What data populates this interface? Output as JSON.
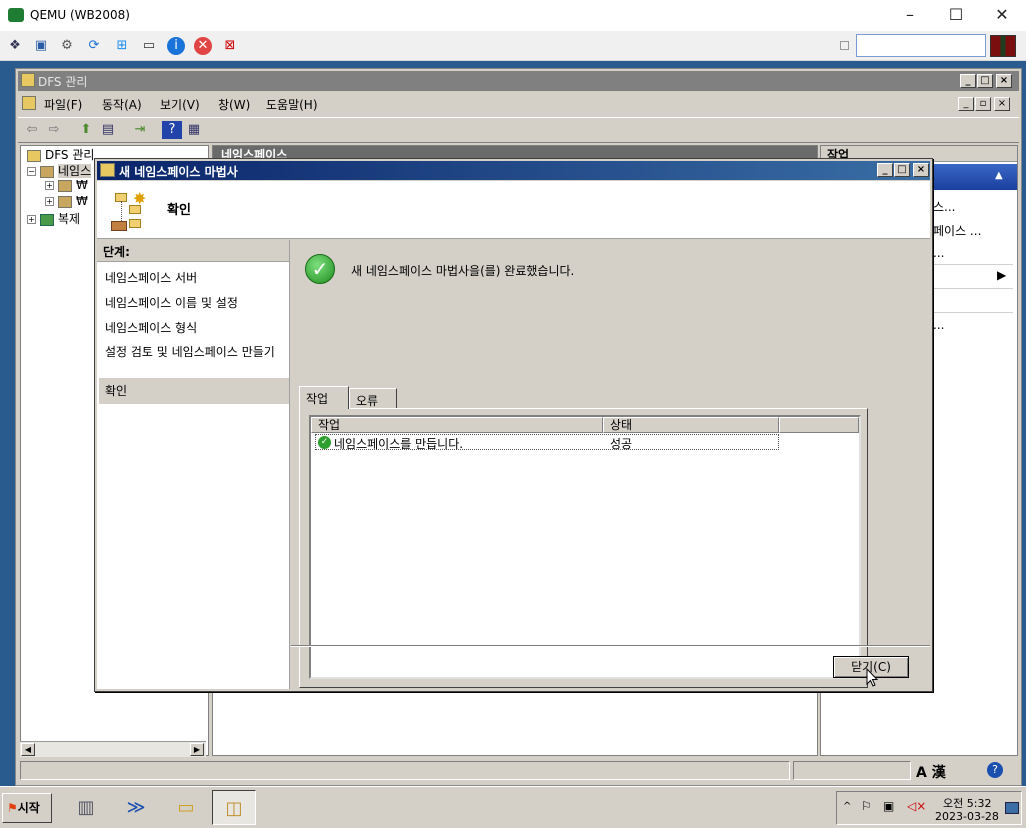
{
  "qemu": {
    "title": "QEMU (WB2008)",
    "minimize": "–",
    "maximize": "☐",
    "close": "✕",
    "toolbar_icons": [
      "network-icon",
      "fullscreen-icon",
      "settings-icon",
      "refresh-icon",
      "windows-icon",
      "usb-icon",
      "info-icon",
      "stop-icon",
      "snapshot-icon"
    ]
  },
  "mmc": {
    "title": "DFS 관리",
    "menu": [
      "파일(F)",
      "동작(A)",
      "보기(V)",
      "창(W)",
      "도움말(H)"
    ],
    "tree": {
      "root": "DFS 관리",
      "namespaces": "네임스",
      "child1": "₩",
      "child2": "₩",
      "replication": "복제"
    },
    "center_header": "네임스페이스",
    "actions": {
      "header": "작업",
      "items": [
        "스...",
        "페이스 ...",
        "...",
        "..."
      ]
    }
  },
  "wizard": {
    "title": "새 네임스페이스 마법사",
    "heading": "확인",
    "steps_header": "단계:",
    "steps": [
      "네임스페이스 서버",
      "네임스페이스 이름 및 설정",
      "네임스페이스 형식",
      "설정 검토 및 네임스페이스 만들기",
      "확인"
    ],
    "success_message": "새 네임스페이스 마법사을(를) 완료했습니다.",
    "tabs": [
      "작업",
      "오류"
    ],
    "columns": [
      "작업",
      "상태"
    ],
    "rows": [
      {
        "task": "네임스페이스를 만듭니다.",
        "status": "성공"
      }
    ],
    "close_button": "닫기(C)"
  },
  "taskbar": {
    "start": "시작",
    "time": "오전 5:32",
    "date": "2023-03-28",
    "ime": "A 漢"
  }
}
